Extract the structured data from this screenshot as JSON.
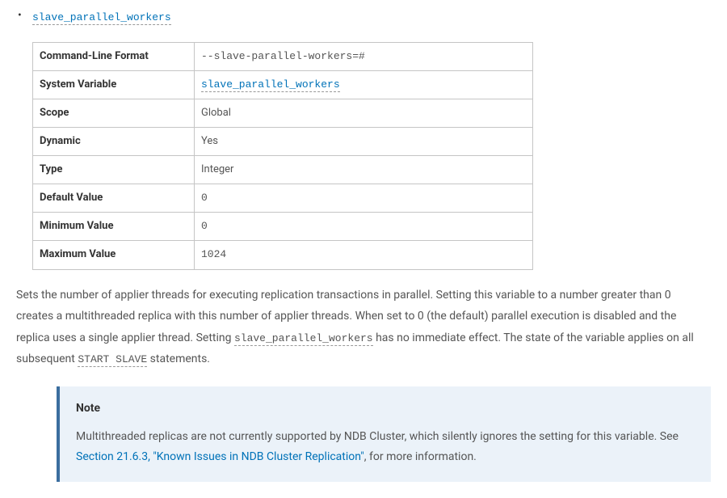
{
  "item": {
    "name": "slave_parallel_workers"
  },
  "table": {
    "rows": [
      {
        "label": "Command-Line Format",
        "value": "--slave-parallel-workers=#",
        "type": "code"
      },
      {
        "label": "System Variable",
        "value": "slave_parallel_workers",
        "type": "link-code"
      },
      {
        "label": "Scope",
        "value": "Global",
        "type": "text"
      },
      {
        "label": "Dynamic",
        "value": "Yes",
        "type": "text"
      },
      {
        "label": "Type",
        "value": "Integer",
        "type": "text"
      },
      {
        "label": "Default Value",
        "value": "0",
        "type": "code-plain"
      },
      {
        "label": "Minimum Value",
        "value": "0",
        "type": "code-plain"
      },
      {
        "label": "Maximum Value",
        "value": "1024",
        "type": "code-plain"
      }
    ]
  },
  "description": {
    "part1": "Sets the number of applier threads for executing replication transactions in parallel. Setting this variable to a number greater than 0 creates a multithreaded replica with this number of applier threads. When set to 0 (the default) parallel execution is disabled and the replica uses a single applier thread. Setting ",
    "code1": "slave_parallel_workers",
    "part2": " has no immediate effect. The state of the variable applies on all subsequent ",
    "code2": "START SLAVE",
    "part3": " statements."
  },
  "note": {
    "title": "Note",
    "body_part1": "Multithreaded replicas are not currently supported by NDB Cluster, which silently ignores the setting for this variable. See ",
    "link_text": "Section 21.6.3, \"Known Issues in NDB Cluster Replication\"",
    "body_part2": ", for more information."
  }
}
